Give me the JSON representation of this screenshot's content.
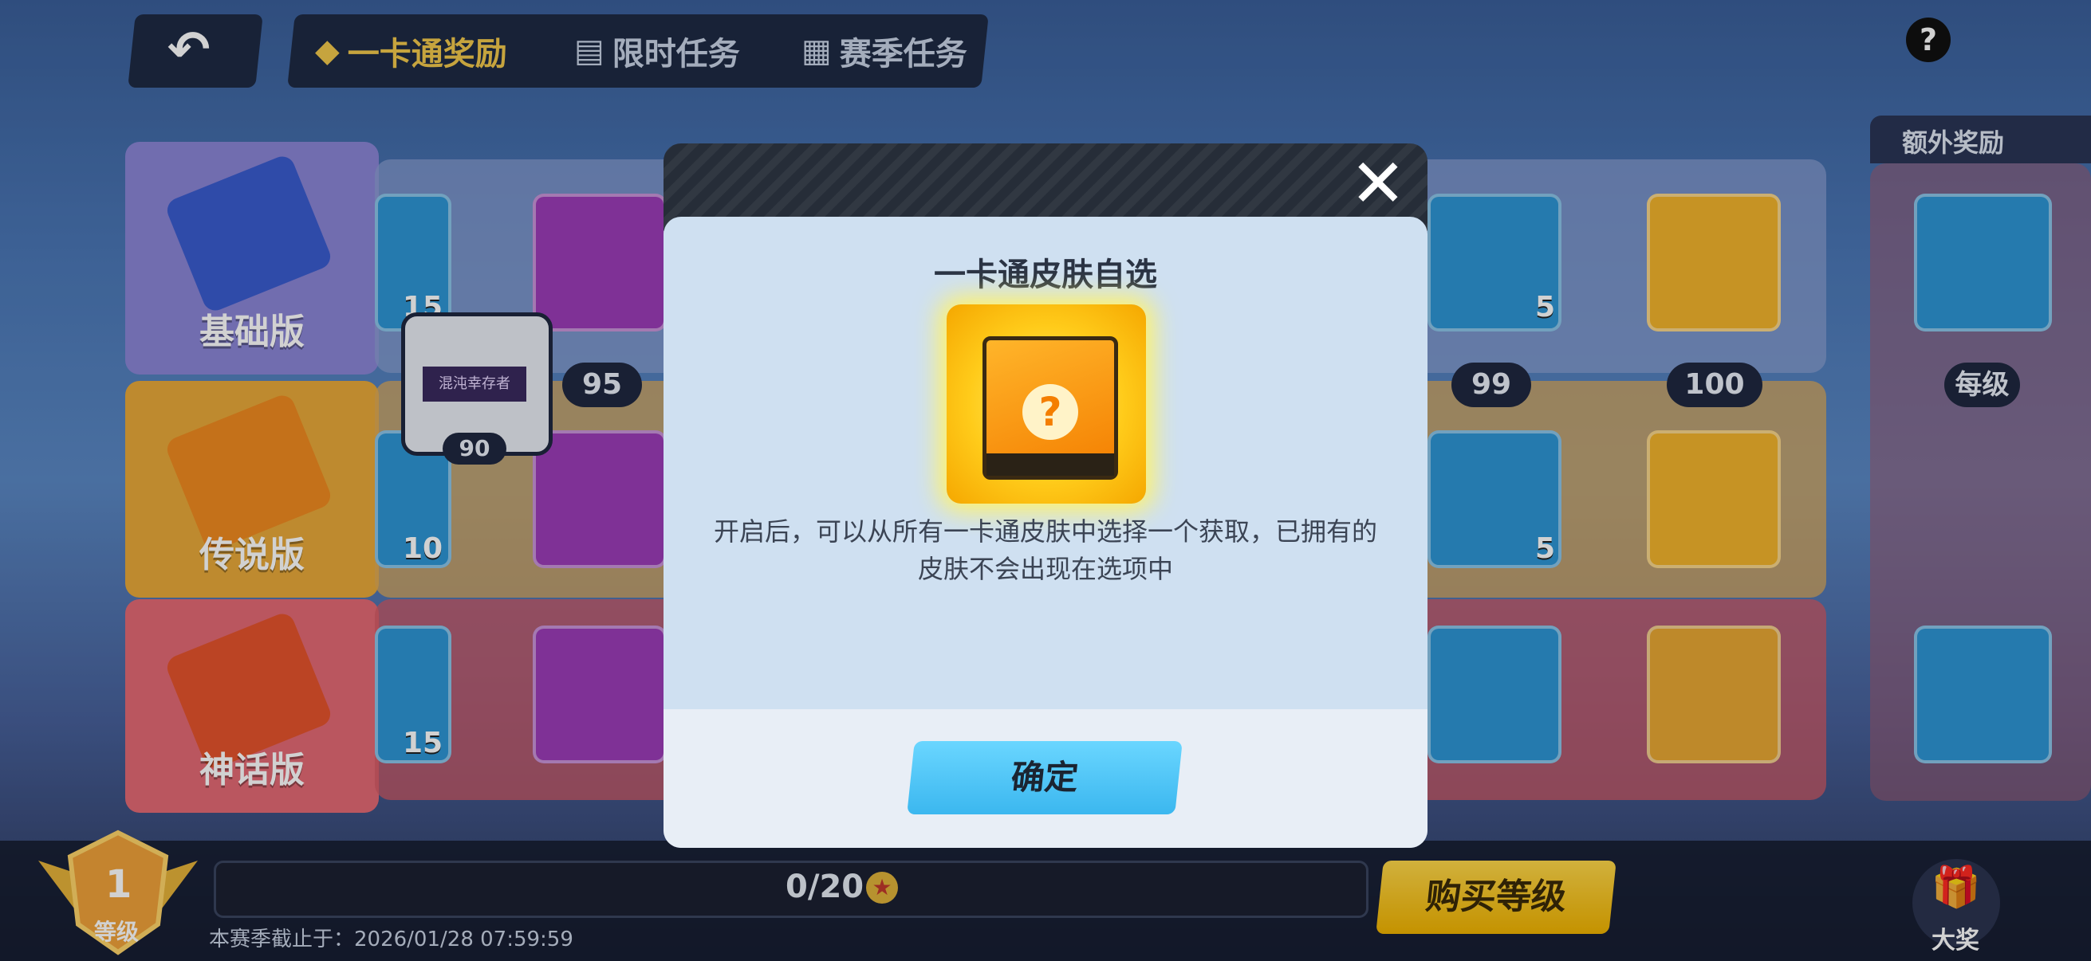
{
  "tabs": [
    {
      "label": "一卡通奖励",
      "icon": "card-icon",
      "active": true
    },
    {
      "label": "限时任务",
      "icon": "clock-list-icon",
      "active": false
    },
    {
      "label": "赛季任务",
      "icon": "calendar-list-icon",
      "active": false
    }
  ],
  "help": "?",
  "extra_rewards": {
    "title": "额外奖励",
    "per_level": "每级"
  },
  "tiers": [
    {
      "label": "基础版",
      "color": "#7b7fe0"
    },
    {
      "label": "传说版",
      "color": "#f3b234"
    },
    {
      "label": "神话版",
      "color": "#e4545e"
    }
  ],
  "track": {
    "levels": [
      "95",
      "99",
      "100"
    ],
    "current_badge": {
      "text": "混沌幸存者",
      "level": "90"
    },
    "counts": {
      "left_top": "15",
      "left_mid": "10",
      "left_bot": "15",
      "right_top": "5",
      "right_mid": "5"
    }
  },
  "modal": {
    "title": "一卡通皮肤自选",
    "description_line1": "开启后，可以从所有一卡通皮肤中选择一个获取，已拥有的",
    "description_line2": "皮肤不会出现在选项中",
    "confirm": "确定",
    "close": "✕"
  },
  "bottom": {
    "level_num": "1",
    "level_label": "等级",
    "progress": "0/20",
    "progress_fraction": 0,
    "buy": "购买等级",
    "deadline": "本赛季截止于：2026/01/28 07:59:59",
    "grand_prize": "大奖"
  },
  "colors": {
    "accent_blue": "#4cc6f7",
    "accent_yellow": "#f7c531",
    "tab_active": "#f2c94c"
  }
}
